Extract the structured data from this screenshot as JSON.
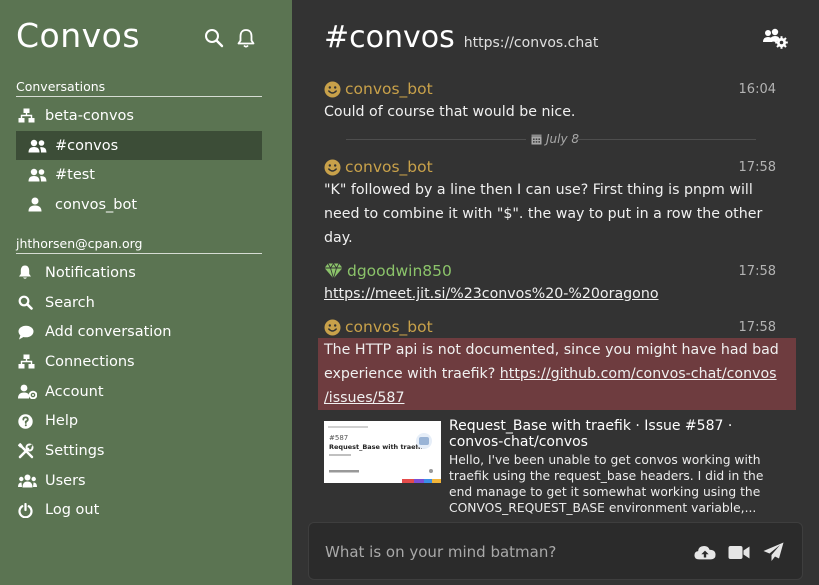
{
  "app": {
    "title": "Convos"
  },
  "sidebar": {
    "conversations_label": "Conversations",
    "conversations": [
      {
        "label": "beta-convos",
        "icon": "network-icon"
      },
      {
        "label": "#convos",
        "icon": "users-icon",
        "active": true
      },
      {
        "label": "#test",
        "icon": "users-icon"
      },
      {
        "label": "convos_bot",
        "icon": "user-icon"
      }
    ],
    "account_label": "jhthorsen@cpan.org",
    "menu": [
      {
        "label": "Notifications",
        "icon": "bell-icon"
      },
      {
        "label": "Search",
        "icon": "search-icon"
      },
      {
        "label": "Add conversation",
        "icon": "comment-icon"
      },
      {
        "label": "Connections",
        "icon": "network-icon"
      },
      {
        "label": "Account",
        "icon": "user-gear-icon"
      },
      {
        "label": "Help",
        "icon": "question-icon"
      },
      {
        "label": "Settings",
        "icon": "tools-icon"
      },
      {
        "label": "Users",
        "icon": "users-icon"
      },
      {
        "label": "Log out",
        "icon": "power-icon"
      }
    ]
  },
  "header": {
    "title": "#convos",
    "url": "https://convos.chat"
  },
  "messages": [
    {
      "nick": "convos_bot",
      "time": "16:04",
      "text": "Could of course that would be nice."
    },
    {
      "nick": "convos_bot",
      "time": "17:58",
      "text": "\"K\" followed by a line then I can use? First thing is pnpm will need to combine it with \"$\". the way to put in a row the other day."
    },
    {
      "nick": "dgoodwin850",
      "time": "17:58",
      "link": "https://meet.jit.si/%23convos%20-%20oragono"
    },
    {
      "nick": "convos_bot",
      "time": "17:58",
      "text": "The HTTP api is not documented, since you might have had bad experience with traefik? ",
      "link": "https://github.com/convos-chat/convos/issues/587",
      "link_line1": "https://github.com/convos-chat/convos",
      "link_line2": "/issues/587"
    }
  ],
  "day_separator": "July 8",
  "embed": {
    "title": "Request_Base with traefik · Issue #587 · convos-chat/convos",
    "description": "Hello, I've been unable to get convos working with traefik using the request_base headers. I did in the end manage to get it somewhat working using the CONVOS_REQUEST_BASE environment variable,...",
    "thumb_number": "#587",
    "thumb_title": "Request_Base with traefik"
  },
  "composer": {
    "placeholder": "What is on your mind batman?"
  },
  "colors": {
    "sidebar": "#5b7452",
    "active": "#3c4d37",
    "main": "#333333",
    "highlight": "#6e3c3f",
    "nick_bot": "#c8a14a",
    "nick_user": "#8bc36a"
  }
}
